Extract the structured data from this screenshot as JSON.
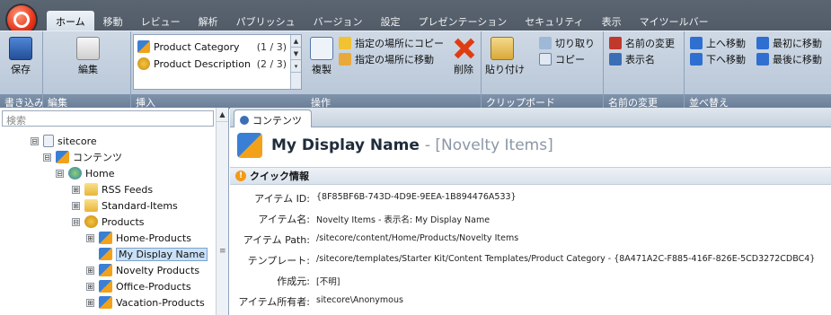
{
  "ribbon": {
    "tabs": [
      "ホーム",
      "移動",
      "レビュー",
      "解析",
      "パブリッシュ",
      "バージョン",
      "設定",
      "プレゼンテーション",
      "セキュリティ",
      "表示",
      "マイツールバー"
    ],
    "save": {
      "label": "保存",
      "group": "書き込み"
    },
    "edit": {
      "label": "編集",
      "group": "編集"
    },
    "insert": {
      "group": "挿入",
      "items": [
        {
          "label": "Product Category",
          "count": "(1 / 3)"
        },
        {
          "label": "Product Description",
          "count": "(2 / 3)"
        }
      ]
    },
    "ops": {
      "group": "操作",
      "duplicate": "複製",
      "copy_to": "指定の場所にコピー",
      "move_to": "指定の場所に移動",
      "delete": "削除"
    },
    "clipboard": {
      "group": "クリップボード",
      "paste": "貼り付け",
      "cut": "切り取り",
      "copy": "コピー"
    },
    "rename": {
      "group": "名前の変更",
      "rename": "名前の変更",
      "display_name": "表示名"
    },
    "sort": {
      "group": "並べ替え",
      "up": "上へ移動",
      "first": "最初に移動",
      "down": "下へ移動",
      "last": "最後に移動"
    }
  },
  "tree": {
    "search_placeholder": "検索",
    "nodes": [
      {
        "label": "sitecore",
        "exp": "⊟"
      },
      {
        "label": "コンテンツ",
        "exp": "⊟"
      },
      {
        "label": "Home",
        "exp": "⊟"
      },
      {
        "label": "RSS Feeds",
        "exp": "⊞"
      },
      {
        "label": "Standard-Items",
        "exp": "⊞"
      },
      {
        "label": "Products",
        "exp": "⊟"
      },
      {
        "label": "Home-Products",
        "exp": "⊞"
      },
      {
        "label": "My Display Name",
        "exp": ""
      },
      {
        "label": "Novelty Products",
        "exp": "⊞"
      },
      {
        "label": "Office-Products",
        "exp": "⊞"
      },
      {
        "label": "Vacation-Products",
        "exp": "⊞"
      }
    ]
  },
  "content": {
    "tab": "コンテンツ",
    "title": "My Display Name",
    "subtitle": "- [Novelty Items]",
    "quick_info": "クイック情報",
    "fields": [
      {
        "key": "アイテム ID:",
        "value": "{8F85BF6B-743D-4D9E-9EEA-1B894476A533}"
      },
      {
        "key": "アイテム名:",
        "value": "Novelty Items - 表示名: My Display Name"
      },
      {
        "key": "アイテム Path:",
        "value": "/sitecore/content/Home/Products/Novelty Items"
      },
      {
        "key": "テンプレート:",
        "value": "/sitecore/templates/Starter Kit/Content Templates/Product Category - {8A471A2C-F885-416F-826E-5CD3272CDBC4}"
      },
      {
        "key": "作成元:",
        "value": "[不明]"
      },
      {
        "key": "アイテム所有者:",
        "value": "sitecore\\Anonymous"
      }
    ]
  },
  "colors": {
    "accent": "#3b6fb5",
    "orb": "#e53318",
    "ribbon_panel": "#c2cfde"
  },
  "icons": [
    "app-orb-icon",
    "save-icon",
    "edit-icon",
    "folder-icon",
    "globe-icon",
    "product-icon",
    "delete-icon",
    "paste-icon",
    "info-icon"
  ]
}
